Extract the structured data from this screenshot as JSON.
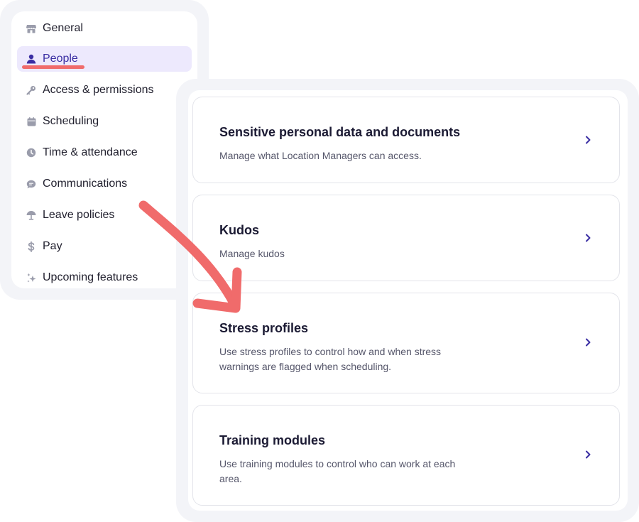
{
  "sidebar": {
    "items": [
      {
        "label": "General",
        "icon": "storefront-icon"
      },
      {
        "label": "People",
        "icon": "person-icon",
        "active": true
      },
      {
        "label": "Access & permissions",
        "icon": "key-icon"
      },
      {
        "label": "Scheduling",
        "icon": "calendar-icon"
      },
      {
        "label": "Time & attendance",
        "icon": "clock-icon"
      },
      {
        "label": "Communications",
        "icon": "chat-icon"
      },
      {
        "label": "Leave policies",
        "icon": "umbrella-icon"
      },
      {
        "label": "Pay",
        "icon": "dollar-icon"
      },
      {
        "label": "Upcoming features",
        "icon": "sparkle-icon"
      }
    ]
  },
  "main": {
    "cards": [
      {
        "title": "Sensitive personal data and documents",
        "description": "Manage what Location Managers can access."
      },
      {
        "title": "Kudos",
        "description": "Manage kudos"
      },
      {
        "title": "Stress profiles",
        "description": "Use stress profiles to control how and when stress warnings are flagged when scheduling."
      },
      {
        "title": "Training modules",
        "description": "Use training modules to control who can work at each area."
      }
    ]
  },
  "colors": {
    "accent": "#3a2ea3",
    "active_bg": "#ede9fd",
    "annotation": "#f06b6b",
    "icon_gray": "#9a9cab",
    "frame_bg": "#f3f4f8"
  }
}
